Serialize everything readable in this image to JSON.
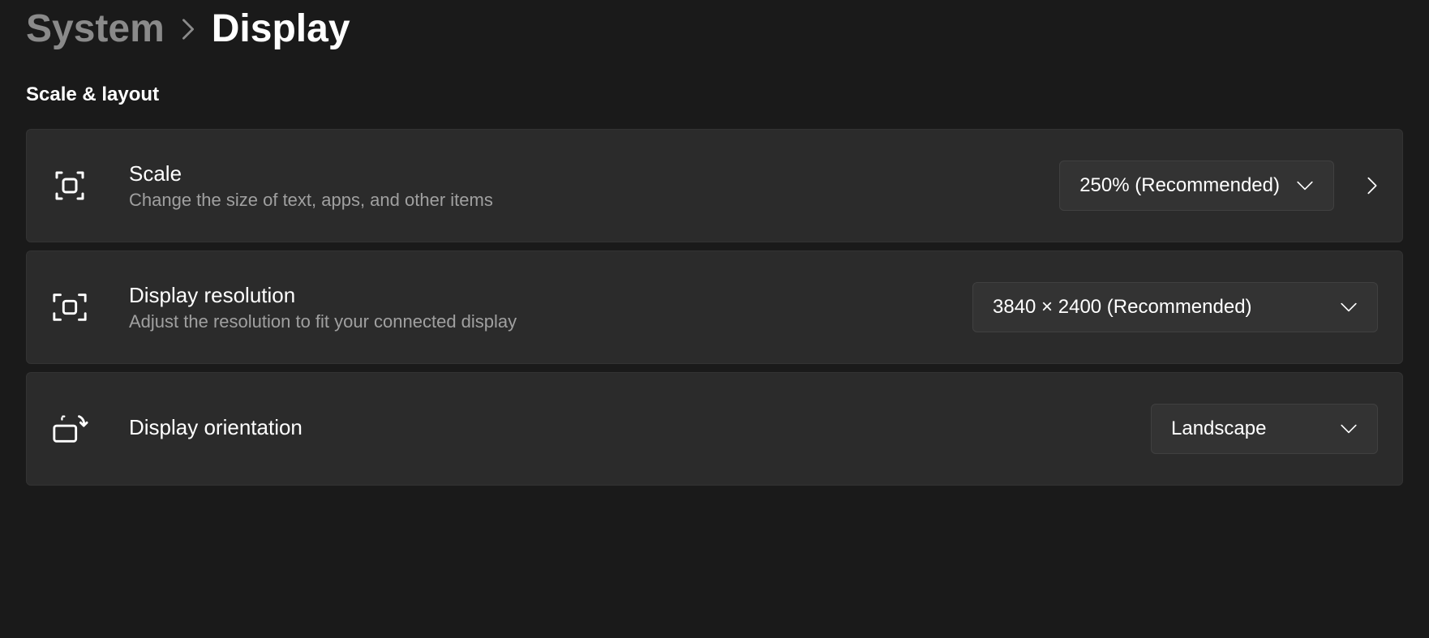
{
  "breadcrumb": {
    "parent": "System",
    "current": "Display"
  },
  "section": {
    "title": "Scale & layout"
  },
  "settings": {
    "scale": {
      "title": "Scale",
      "description": "Change the size of text, apps, and other items",
      "value": "250% (Recommended)"
    },
    "resolution": {
      "title": "Display resolution",
      "description": "Adjust the resolution to fit your connected display",
      "value": "3840 × 2400 (Recommended)"
    },
    "orientation": {
      "title": "Display orientation",
      "value": "Landscape"
    }
  }
}
